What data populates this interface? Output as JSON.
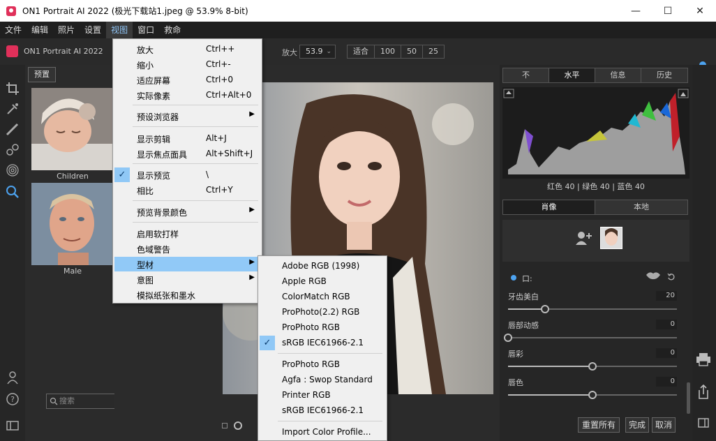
{
  "window": {
    "title": "ON1 Portrait AI 2022 (极光下载站1.jpeg @ 53.9% 8-bit)",
    "controls": [
      "—",
      "☐",
      "✕"
    ]
  },
  "menubar": [
    "文件",
    "编辑",
    "照片",
    "设置",
    "视图",
    "窗口",
    "救命"
  ],
  "app": {
    "name": "ON1 Portrait AI 2022"
  },
  "zoom": {
    "label": "放大",
    "value": "53.9",
    "presets": [
      "适合",
      "100",
      "50",
      "25"
    ]
  },
  "browser": {
    "preset_button": "预置",
    "thumbs": [
      {
        "label": "Children"
      },
      {
        "label": "Male"
      }
    ],
    "search_placeholder": "搜索"
  },
  "view_menu": {
    "items": [
      {
        "label": "放大",
        "accel": "Ctrl++"
      },
      {
        "label": "缩小",
        "accel": "Ctrl+-"
      },
      {
        "label": "适应屏幕",
        "accel": "Ctrl+0"
      },
      {
        "label": "实际像素",
        "accel": "Ctrl+Alt+0"
      },
      {
        "label": "预设浏览器",
        "accel": ""
      },
      {
        "label": "显示剪辑",
        "accel": "Alt+J"
      },
      {
        "label": "显示焦点面具",
        "accel": "Alt+Shift+J"
      },
      {
        "label": "显示预览",
        "accel": "\\"
      },
      {
        "label": "相比",
        "accel": "Ctrl+Y"
      },
      {
        "label": "预览背景颜色",
        "accel": ""
      },
      {
        "label": "启用软打样",
        "accel": ""
      },
      {
        "label": "色域警告",
        "accel": ""
      },
      {
        "label": "型材",
        "accel": ""
      },
      {
        "label": "意图",
        "accel": ""
      },
      {
        "label": "模拟纸张和墨水",
        "accel": ""
      }
    ]
  },
  "profile_menu": {
    "items": [
      {
        "label": "Adobe RGB (1998)"
      },
      {
        "label": "Apple RGB"
      },
      {
        "label": "ColorMatch RGB"
      },
      {
        "label": "ProPhoto(2.2) RGB"
      },
      {
        "label": "ProPhoto RGB"
      },
      {
        "label": "sRGB IEC61966-2.1"
      },
      {
        "label": "ProPhoto RGB"
      },
      {
        "label": "Agfa : Swop Standard"
      },
      {
        "label": "Printer RGB"
      },
      {
        "label": "sRGB IEC61966-2.1"
      },
      {
        "label": "Import Color Profile..."
      }
    ]
  },
  "right_panel": {
    "top_tabs": [
      "不",
      "水平",
      "信息",
      "历史"
    ],
    "histogram_readout": "红色  40  | 绿色  40  | 蓝色  40",
    "mode_tabs": [
      "肖像",
      "本地"
    ],
    "section_label": "口:",
    "adjustments": [
      {
        "label": "牙齿美白",
        "value": "20",
        "pct": 0.22
      },
      {
        "label": "唇部动感",
        "value": "0",
        "pct": 0.0
      },
      {
        "label": "唇彩",
        "value": "0",
        "pct": 0.5
      },
      {
        "label": "唇色",
        "value": "0",
        "pct": 0.5
      }
    ]
  },
  "bottom_buttons": {
    "reset": "重置所有",
    "done": "完成",
    "cancel": "取消"
  },
  "colors": {
    "accent": "#e0305a",
    "menu_highlight": "#91c9f7"
  }
}
